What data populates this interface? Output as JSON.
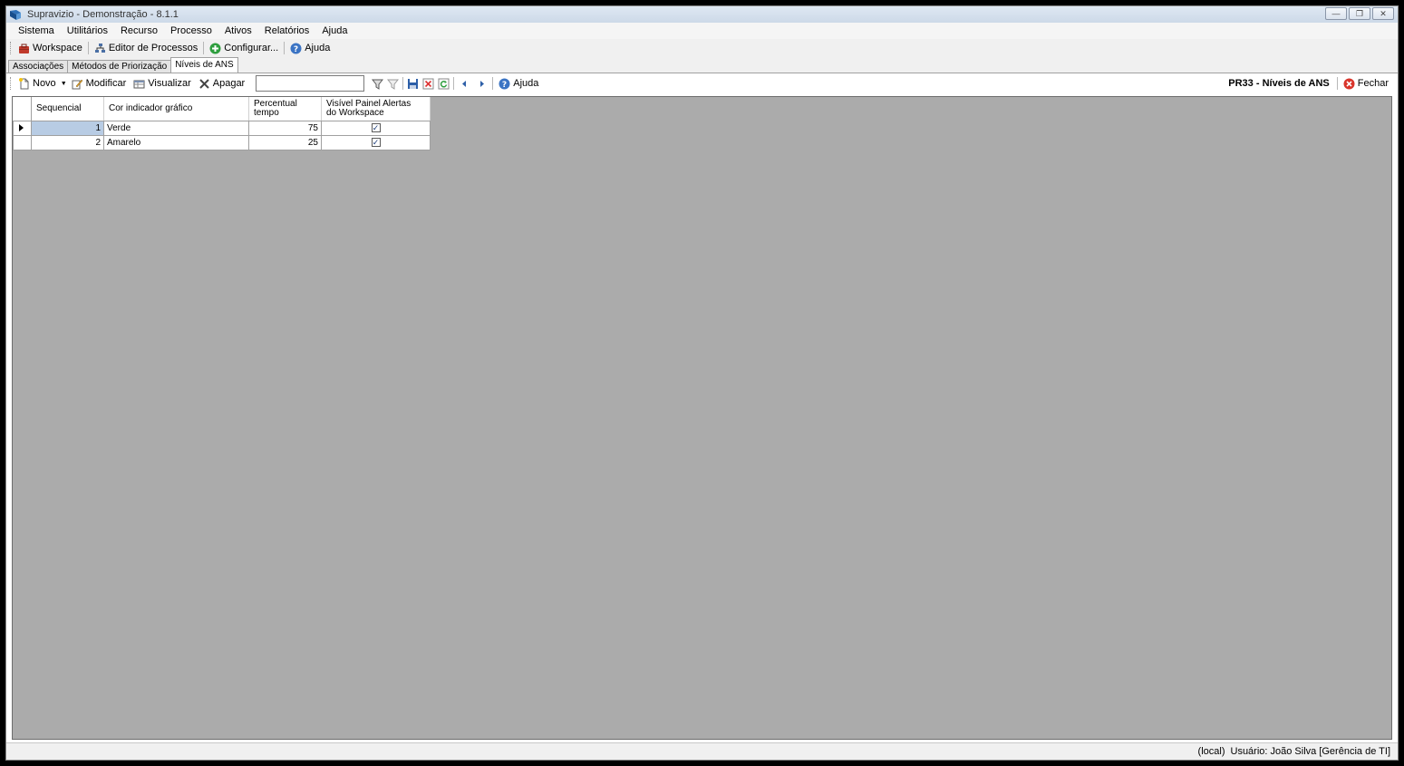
{
  "window": {
    "title": "Supravizio - Demonstração - 8.1.1",
    "controls": [
      "minimize",
      "restore",
      "close"
    ]
  },
  "menu": [
    "Sistema",
    "Utilitários",
    "Recurso",
    "Processo",
    "Ativos",
    "Relatórios",
    "Ajuda"
  ],
  "toolbar1": {
    "workspace": "Workspace",
    "editor": "Editor de Processos",
    "configurar": "Configurar...",
    "ajuda": "Ajuda"
  },
  "tabs": [
    "Associações",
    "Métodos de Priorização",
    "Níveis de ANS"
  ],
  "toolbar2": {
    "novo": "Novo",
    "modificar": "Modificar",
    "visualizar": "Visualizar",
    "apagar": "Apagar",
    "filter_value": "",
    "ajuda": "Ajuda",
    "form_title": "PR33 - Níveis de ANS",
    "fechar": "Fechar"
  },
  "grid": {
    "columns": [
      "Sequencial",
      "Cor indicador gráfico",
      "Percentual tempo",
      "Visível Painel Alertas do Workspace"
    ],
    "rows": [
      {
        "sequencial": "1",
        "cor": "Verde",
        "percentual": "75",
        "visivel": true
      },
      {
        "sequencial": "2",
        "cor": "Amarelo",
        "percentual": "25",
        "visivel": true
      }
    ]
  },
  "status": {
    "server": "(local)",
    "user": "Usuário: João Silva [Gerência de TI]"
  },
  "colors": {
    "selected_cell": "#b8cce4",
    "grid_background": "#ababab",
    "fechar_icon": "#d9352b"
  }
}
